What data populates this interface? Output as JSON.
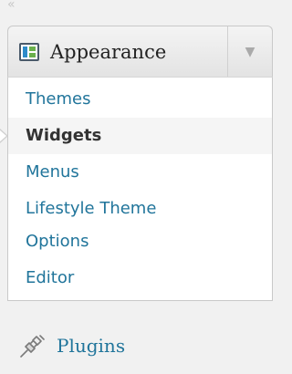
{
  "collapse": {
    "glyph": "«"
  },
  "menu": {
    "title": "Appearance",
    "icon": "appearance-icon",
    "toggle_glyph": "▼",
    "items": [
      {
        "label": "Themes"
      },
      {
        "label": "Widgets",
        "current": true
      },
      {
        "label": "Menus"
      },
      {
        "label": "Lifestyle Theme Options"
      },
      {
        "label": "Editor"
      }
    ]
  },
  "plugins": {
    "label": "Plugins",
    "icon": "plug-icon"
  },
  "colors": {
    "link": "#21759b",
    "current": "#333333",
    "header_bg": "#e8e8e8"
  }
}
